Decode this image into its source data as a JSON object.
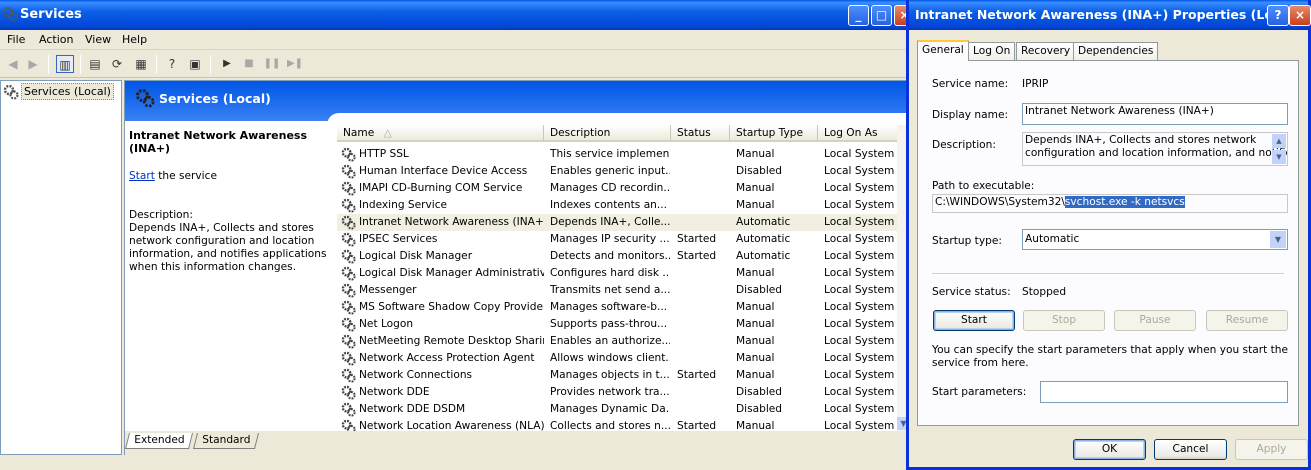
{
  "main": {
    "title": "Services",
    "menu": [
      "File",
      "Action",
      "View",
      "Help"
    ],
    "tree_node": "Services (Local)",
    "header_title": "Services (Local)",
    "detail": {
      "name": "Intranet Network Awareness (INA+)",
      "start_link": "Start",
      "start_suffix": " the service",
      "description_label": "Description:",
      "description": "Depends INA+, Collects and stores network configuration and location information, and notifies applications when this information changes."
    },
    "columns": [
      "Name",
      "Description",
      "Status",
      "Startup Type",
      "Log On As"
    ],
    "rows": [
      {
        "name": "HTTP SSL",
        "desc": "This service implemen...",
        "status": "",
        "startup": "Manual",
        "logon": "Local System"
      },
      {
        "name": "Human Interface Device Access",
        "desc": "Enables generic input...",
        "status": "",
        "startup": "Disabled",
        "logon": "Local System"
      },
      {
        "name": "IMAPI CD-Burning COM Service",
        "desc": "Manages CD recordin...",
        "status": "",
        "startup": "Manual",
        "logon": "Local System"
      },
      {
        "name": "Indexing Service",
        "desc": "Indexes contents an...",
        "status": "",
        "startup": "Manual",
        "logon": "Local System"
      },
      {
        "name": "Intranet Network Awareness (INA+)",
        "desc": "Depends INA+, Colle...",
        "status": "",
        "startup": "Automatic",
        "logon": "Local System"
      },
      {
        "name": "IPSEC Services",
        "desc": "Manages IP security ...",
        "status": "Started",
        "startup": "Automatic",
        "logon": "Local System"
      },
      {
        "name": "Logical Disk Manager",
        "desc": "Detects and monitors...",
        "status": "Started",
        "startup": "Automatic",
        "logon": "Local System"
      },
      {
        "name": "Logical Disk Manager Administrative...",
        "desc": "Configures hard disk ...",
        "status": "",
        "startup": "Manual",
        "logon": "Local System"
      },
      {
        "name": "Messenger",
        "desc": "Transmits net send a...",
        "status": "",
        "startup": "Disabled",
        "logon": "Local System"
      },
      {
        "name": "MS Software Shadow Copy Provider",
        "desc": "Manages software-b...",
        "status": "",
        "startup": "Manual",
        "logon": "Local System"
      },
      {
        "name": "Net Logon",
        "desc": "Supports pass-throu...",
        "status": "",
        "startup": "Manual",
        "logon": "Local System"
      },
      {
        "name": "NetMeeting Remote Desktop Sharing",
        "desc": "Enables an authorize...",
        "status": "",
        "startup": "Manual",
        "logon": "Local System"
      },
      {
        "name": "Network Access Protection Agent",
        "desc": "Allows windows client...",
        "status": "",
        "startup": "Manual",
        "logon": "Local System"
      },
      {
        "name": "Network Connections",
        "desc": "Manages objects in t...",
        "status": "Started",
        "startup": "Manual",
        "logon": "Local System"
      },
      {
        "name": "Network DDE",
        "desc": "Provides network tra...",
        "status": "",
        "startup": "Disabled",
        "logon": "Local System"
      },
      {
        "name": "Network DDE DSDM",
        "desc": "Manages Dynamic Da...",
        "status": "",
        "startup": "Disabled",
        "logon": "Local System"
      },
      {
        "name": "Network Location Awareness (NLA)",
        "desc": "Collects and stores n...",
        "status": "Started",
        "startup": "Manual",
        "logon": "Local System"
      }
    ],
    "tab_extended": "Extended",
    "tab_standard": "Standard"
  },
  "dialog": {
    "title": "Intranet Network Awareness (INA+) Properties (Local ...",
    "tabs": [
      "General",
      "Log On",
      "Recovery",
      "Dependencies"
    ],
    "service_name_label": "Service name:",
    "service_name": "IPRIP",
    "display_name_label": "Display name:",
    "display_name": "Intranet Network Awareness (INA+)",
    "description_label": "Description:",
    "description_line1": "Depends INA+, Collects and stores network",
    "description_line2": "configuration and location information, and notifies",
    "path_label": "Path to executable:",
    "path_prefix": "C:\\WINDOWS\\System32\\",
    "path_selected": "svchost.exe -k netsvcs",
    "startup_type_label": "Startup type:",
    "startup_type": "Automatic",
    "service_status_label": "Service status:",
    "service_status": "Stopped",
    "btn_start": "Start",
    "btn_stop": "Stop",
    "btn_pause": "Pause",
    "btn_resume": "Resume",
    "hint": "You can specify the start parameters that apply when you start the service from here.",
    "start_params_label": "Start parameters:",
    "start_params": "",
    "btn_ok": "OK",
    "btn_cancel": "Cancel",
    "btn_apply": "Apply"
  }
}
